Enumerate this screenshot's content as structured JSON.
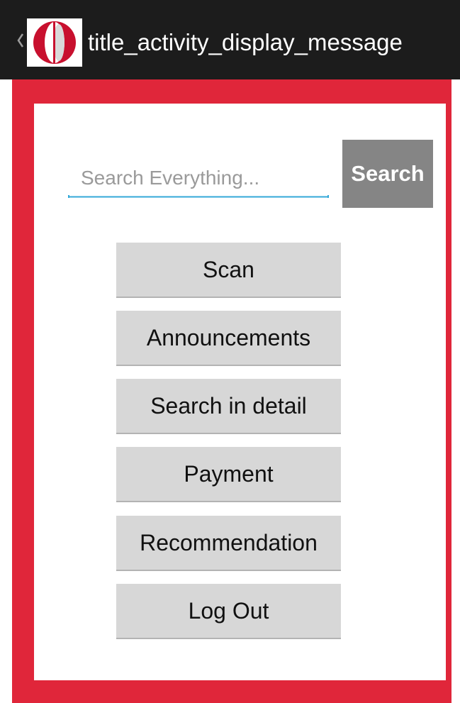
{
  "action_bar": {
    "title": "title_activity_display_message",
    "background": "#1c1c1c",
    "back_icon": "chevron-left-icon",
    "logo_icon": "app-logo-icon"
  },
  "colors": {
    "frame": "#e0263a",
    "panel": "#ffffff",
    "accent_underline": "#33a8d8",
    "search_button": "#858585",
    "menu_button": "#d7d7d7"
  },
  "search": {
    "placeholder": "Search Everything...",
    "value": "",
    "button_label": "Search"
  },
  "menu": {
    "scan": "Scan",
    "announcements": "Announcements",
    "search_in_detail": "Search in detail",
    "payment": "Payment",
    "recommendation": "Recommendation",
    "log_out": "Log Out"
  }
}
